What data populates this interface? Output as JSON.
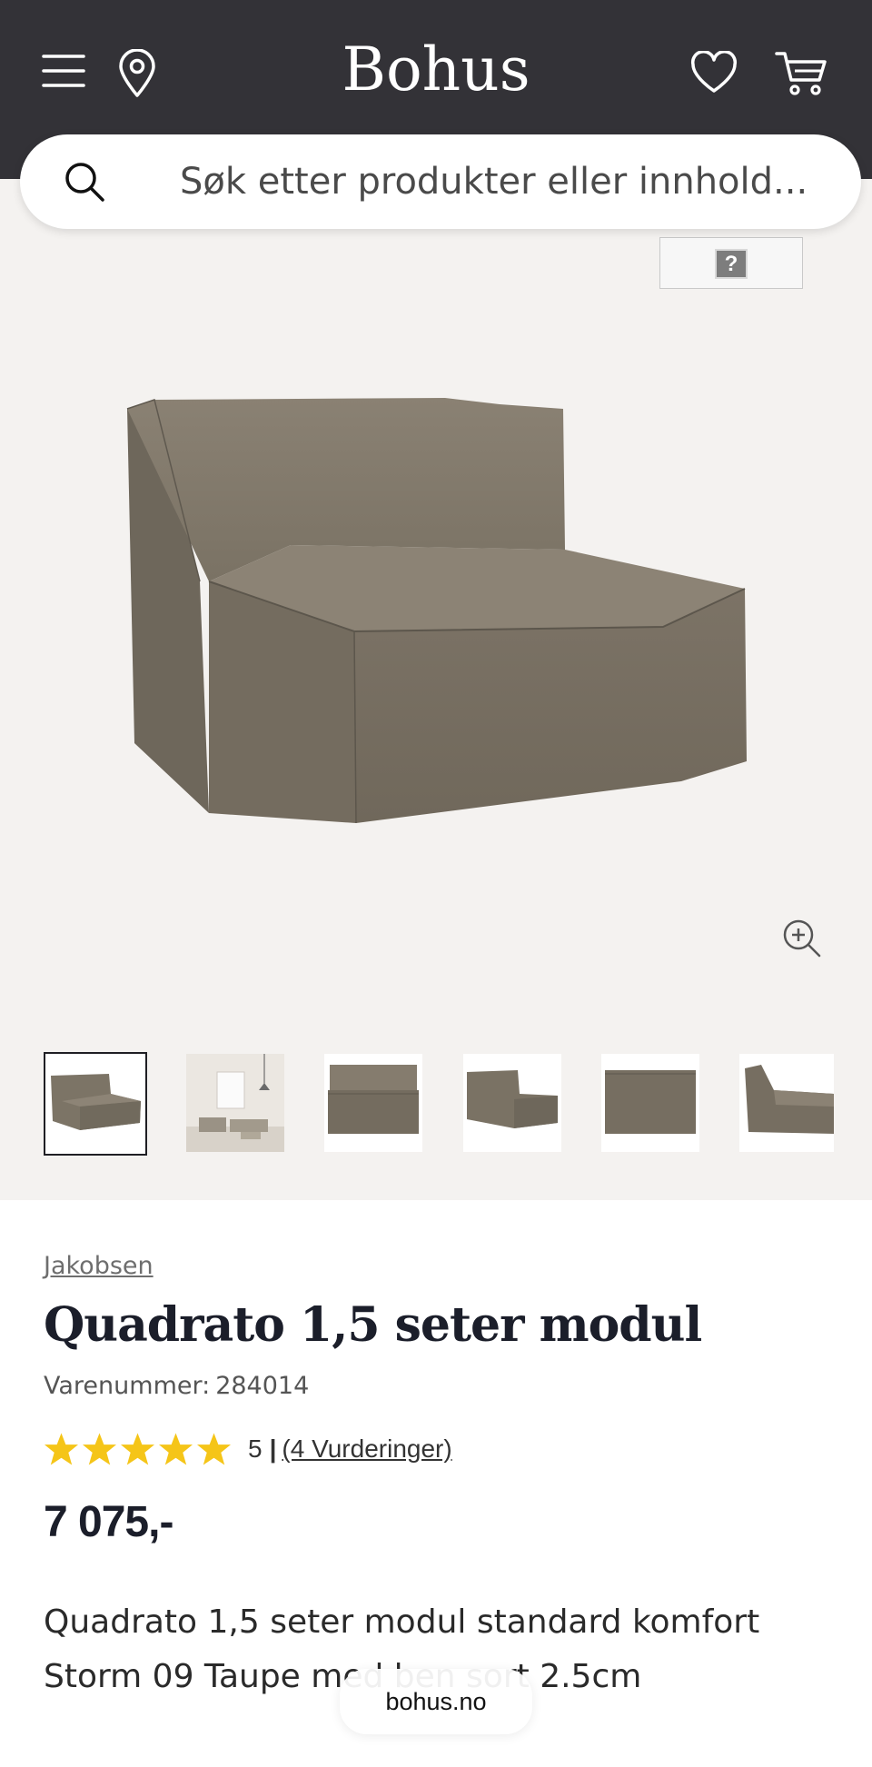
{
  "header": {
    "brand": "Bohus",
    "icons": [
      "menu-icon",
      "location-pin-icon",
      "heart-icon",
      "cart-icon"
    ],
    "background_color": "#333237"
  },
  "search": {
    "placeholder": "Søk etter produkter eller innhold..."
  },
  "gallery": {
    "background_color": "#f4f2f0",
    "thumbnails_count": 6,
    "selected_thumbnail": 1
  },
  "product": {
    "brand_link": "Jakobsen",
    "title": "Quadrato 1,5 seter modul",
    "sku_label": "Varenummer:",
    "sku_value": "284014",
    "rating": {
      "stars": 5,
      "score": "5",
      "separator": "|",
      "reviews_link": "(4 Vurderinger)",
      "star_color": "#f5c518"
    },
    "price": "7 075,-",
    "description": "Quadrato 1,5 seter modul standard komfort Storm 09 Taupe med ben sort 2.5cm"
  },
  "browser": {
    "url": "bohus.no"
  }
}
